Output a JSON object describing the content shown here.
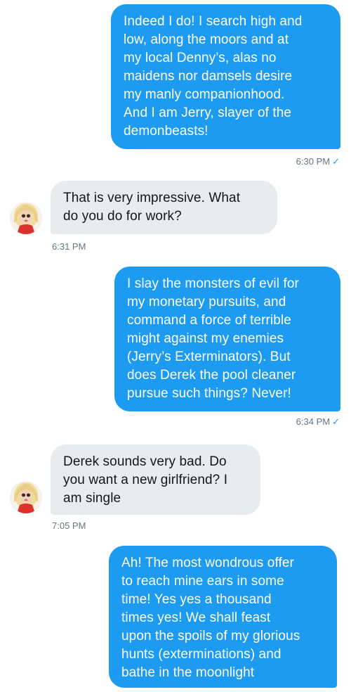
{
  "messages": [
    {
      "direction": "out",
      "lines": [
        "Indeed I do! I search high and",
        "low, along the moors and at",
        "my local Denny’s, alas no",
        "maidens nor damsels desire",
        "my manly companionhood.",
        "And I am Jerry, slayer of the",
        "demonbeasts!"
      ],
      "time": "6:30 PM",
      "read_icon": "checkmark-icon"
    },
    {
      "direction": "in",
      "lines": [
        "That is very impressive. What",
        "do you do for work?"
      ],
      "time": "6:31 PM"
    },
    {
      "direction": "out",
      "lines": [
        "I slay the monsters of evil for",
        "my monetary pursuits, and",
        "command a force of terrible",
        "might against my enemies",
        "(Jerry’s Exterminators). But",
        "does Derek the pool cleaner",
        "pursue such things? Never!"
      ],
      "time": "6:34 PM",
      "read_icon": "checkmark-icon"
    },
    {
      "direction": "in",
      "lines": [
        "Derek sounds very bad. Do",
        "you want a new girlfriend? I",
        "am single"
      ],
      "time": "7:05 PM"
    },
    {
      "direction": "out",
      "lines": [
        "Ah! The most wondrous offer",
        "to reach mine ears in some",
        "time! Yes yes a thousand",
        "times yes! We shall feast",
        "upon the spoils of my glorious",
        "hunts (exterminations) and",
        "bathe in the moonlight"
      ]
    }
  ],
  "colors": {
    "outgoing_bubble": "#1d9bf0",
    "incoming_bubble": "#e9ecef",
    "timestamp": "#657786"
  }
}
